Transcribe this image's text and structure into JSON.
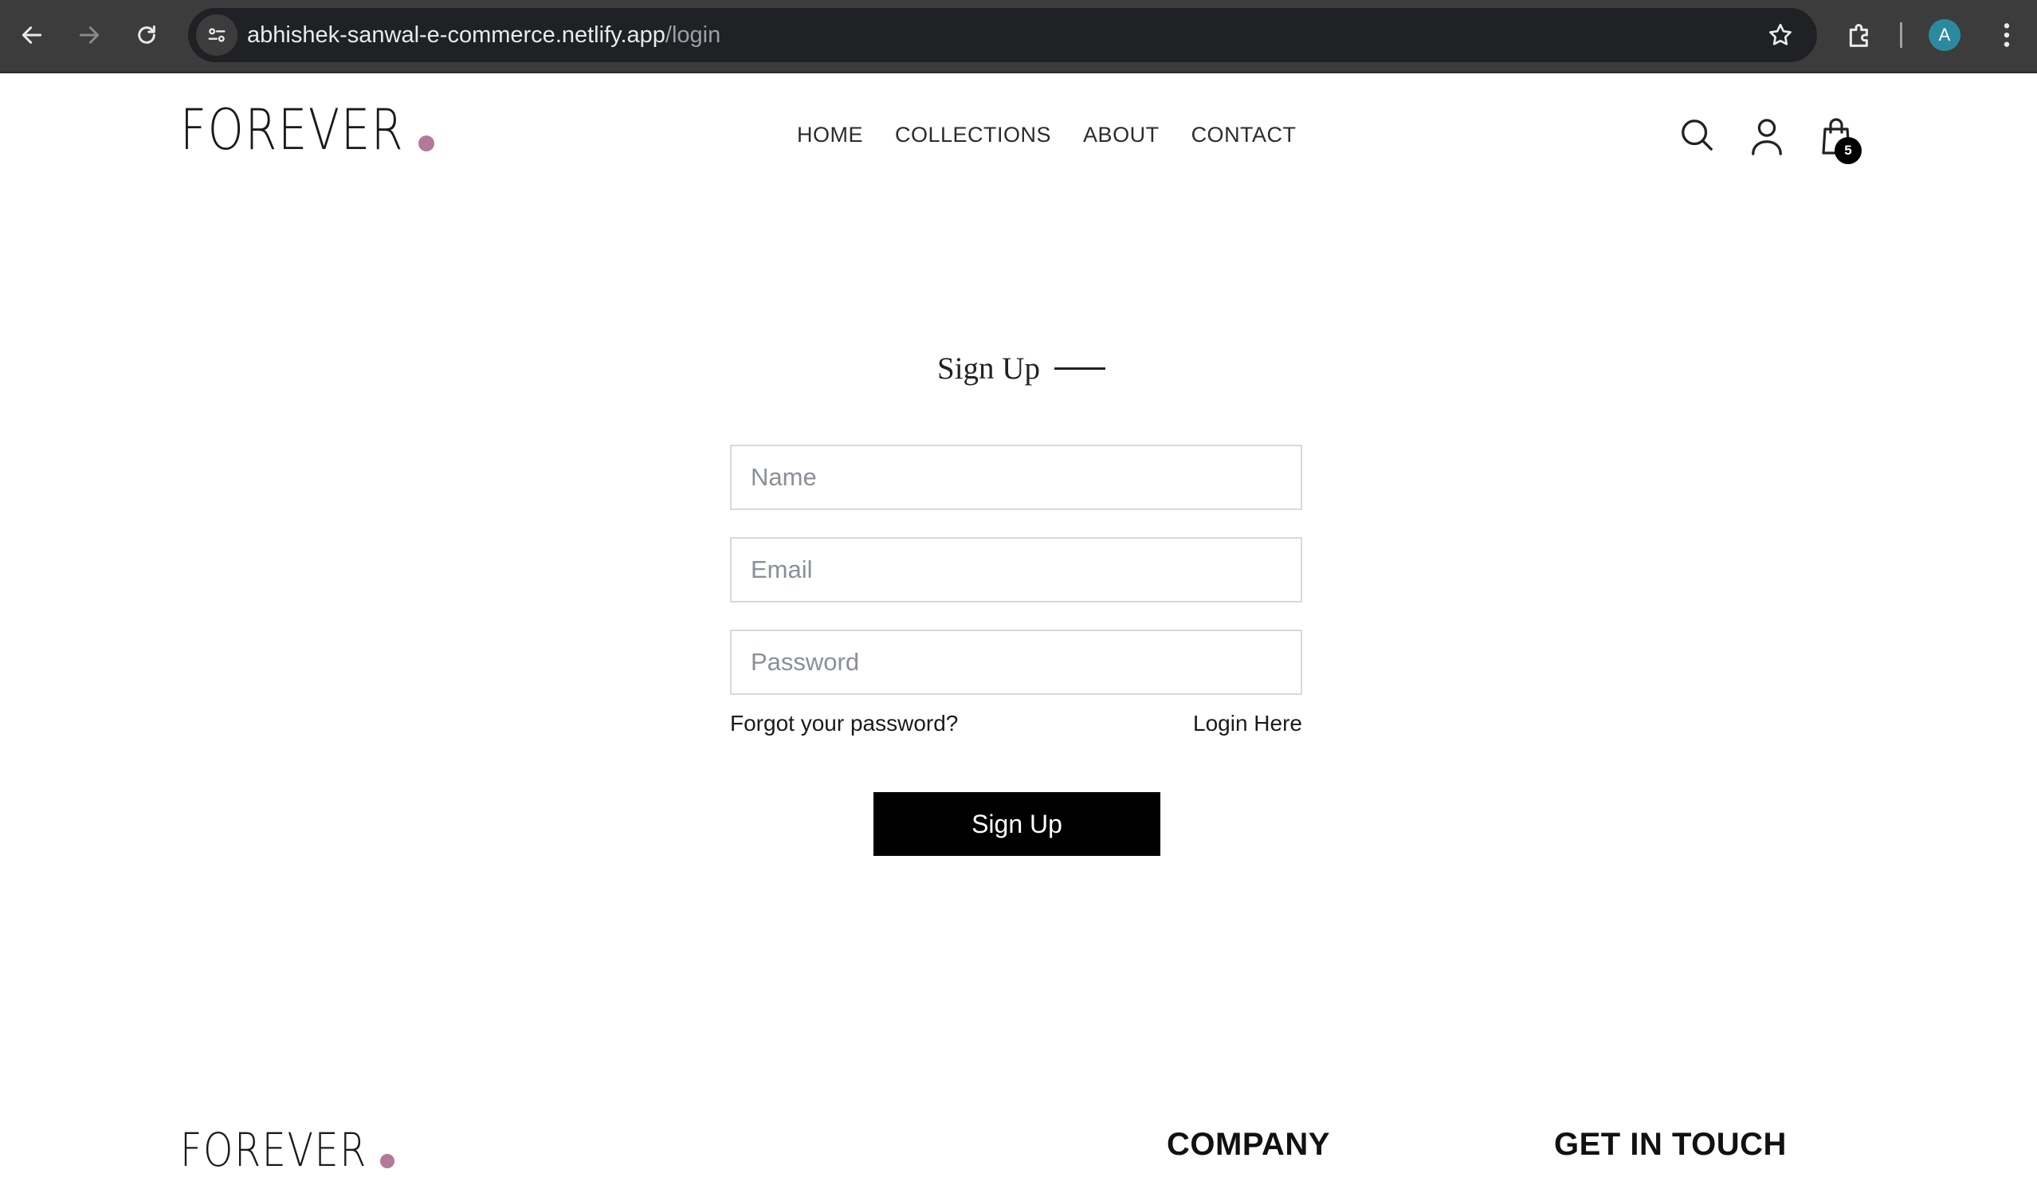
{
  "browser": {
    "url_host": "abhishek-sanwal-e-commerce.netlify.app",
    "url_path": "/login",
    "profile_initial": "A"
  },
  "header": {
    "logo_text": "FOREVER",
    "nav": [
      "HOME",
      "COLLECTIONS",
      "ABOUT",
      "CONTACT"
    ],
    "cart_count": "5",
    "icons": [
      "search-icon",
      "user-icon",
      "shopping-bag-icon"
    ]
  },
  "form": {
    "title": "Sign Up",
    "name_placeholder": "Name",
    "email_placeholder": "Email",
    "password_placeholder": "Password",
    "forgot_label": "Forgot your password?",
    "login_label": "Login Here",
    "submit_label": "Sign Up"
  },
  "footer": {
    "logo_text": "FOREVER",
    "company_heading": "COMPANY",
    "contact_heading": "GET IN TOUCH"
  },
  "colors": {
    "accent_dot": "#b3799b",
    "button_bg": "#000000",
    "chrome_bg": "#3c3c3c"
  }
}
